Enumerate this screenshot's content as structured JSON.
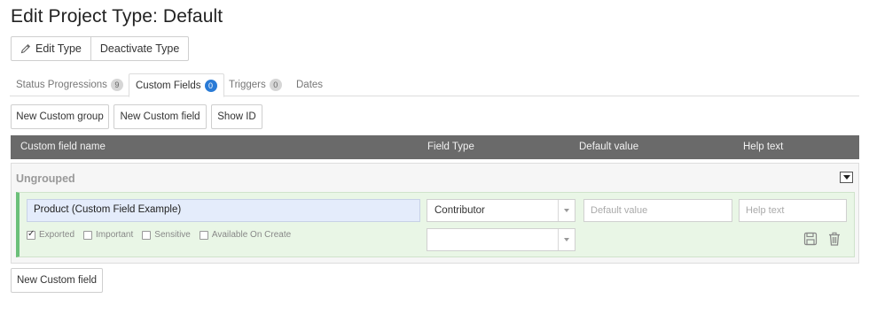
{
  "page": {
    "title": "Edit Project Type: Default"
  },
  "actions": {
    "edit_type": "Edit Type",
    "deactivate_type": "Deactivate Type"
  },
  "tabs": [
    {
      "label": "Status Progressions",
      "count": "9",
      "active": false
    },
    {
      "label": "Custom Fields",
      "count": "0",
      "active": true
    },
    {
      "label": "Triggers",
      "count": "0",
      "active": false
    },
    {
      "label": "Dates",
      "count": null,
      "active": false
    }
  ],
  "toolbar": {
    "new_group": "New Custom group",
    "new_field": "New Custom field",
    "show_id": "Show ID"
  },
  "table": {
    "columns": [
      "Custom field name",
      "Field Type",
      "Default value",
      "Help text"
    ]
  },
  "group": {
    "title": "Ungrouped",
    "field": {
      "name": "Product (Custom Field Example)",
      "field_type": "Contributor",
      "second_select": "",
      "default_value": "",
      "default_placeholder": "Default value",
      "help_text": "",
      "help_placeholder": "Help text",
      "options": [
        {
          "label": "Exported",
          "checked": true
        },
        {
          "label": "Important",
          "checked": false
        },
        {
          "label": "Sensitive",
          "checked": false
        },
        {
          "label": "Available On Create",
          "checked": false
        }
      ]
    }
  },
  "footer": {
    "new_field": "New Custom field"
  },
  "colors": {
    "accent": "#2a7bd6",
    "header_bg": "#6a6a6a",
    "row_bg": "#e9f6e6",
    "row_border": "#6cc07a"
  },
  "icons": {
    "edit": "pencil-icon",
    "save": "save-icon",
    "delete": "trash-icon",
    "collapse": "chevron-down-icon"
  }
}
